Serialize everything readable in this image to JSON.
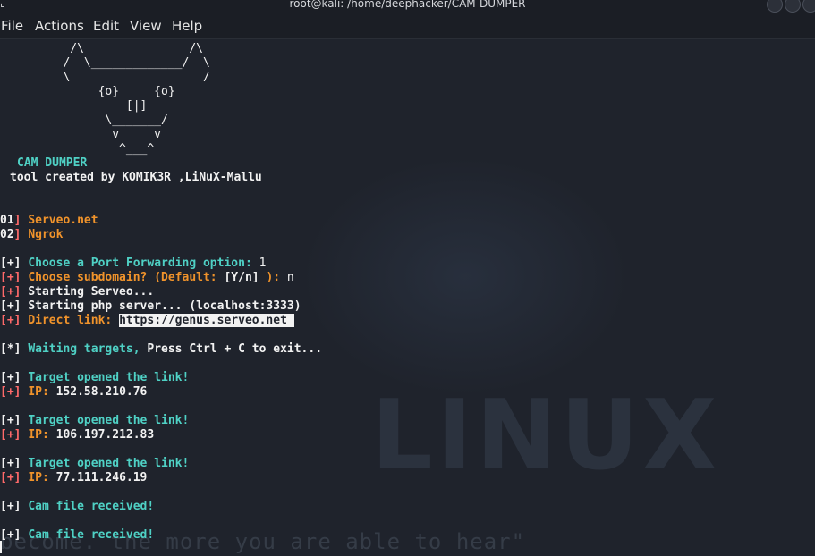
{
  "window": {
    "title": "root@kali: /home/deephacker/CAM-DUMPER"
  },
  "menu": [
    "File",
    "Actions",
    "Edit",
    "View",
    "Help"
  ],
  "watermark": {
    "logo": "LINUX",
    "quote": "become. the more you are able to hear\""
  },
  "banner": [
    "          /\\               /\\",
    "         /  \\_____________/  \\",
    "         \\                   /",
    "              {o}     {o}",
    "                  [|]",
    "               \\_______/",
    "                v     v",
    "                 ^___^"
  ],
  "tool_name": "CAM DUMPER",
  "credit": "tool created by KOMIK3R ,LiNuX-Mallu",
  "options": [
    {
      "num": "01",
      "label": "Serveo.net"
    },
    {
      "num": "02",
      "label": "Ngrok"
    }
  ],
  "log": {
    "choose_port": "Choose a Port Forwarding option:",
    "choose_port_answer": "1",
    "choose_subdomain": "Choose subdomain? (Default:",
    "choose_subdomain_default": "[Y/n]",
    "choose_subdomain_end": "):",
    "choose_subdomain_answer": "n",
    "starting_serveo": "Starting Serveo...",
    "starting_php": "Starting php server... (localhost:3333)",
    "direct_link_label": "Direct link:",
    "direct_link": "https://genus.serveo.net ",
    "waiting": "Waiting targets,",
    "waiting_hint": "Press Ctrl + C to exit...",
    "target_opened": "Target opened the link!",
    "ip_label": "IP:",
    "ips": [
      "152.58.210.76",
      "106.197.212.83",
      "77.111.246.19"
    ],
    "cam_received": "Cam file received!"
  }
}
